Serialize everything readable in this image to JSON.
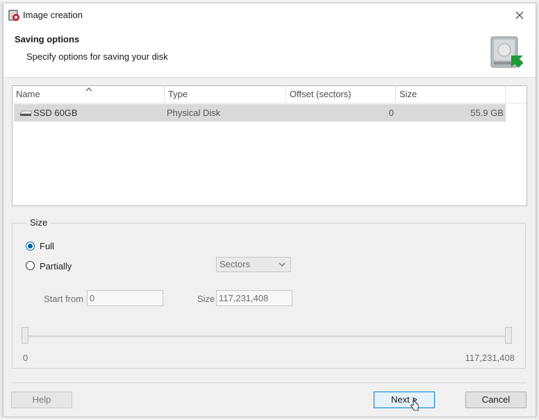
{
  "window": {
    "title": "Image creation",
    "close_icon": "close-icon",
    "app_icon": "image-creation-icon"
  },
  "header": {
    "title": "Saving options",
    "subtitle": "Specify options for saving your disk",
    "icon": "disk-save-icon"
  },
  "disk_list": {
    "columns": [
      "Name",
      "Type",
      "Offset (sectors)",
      "Size"
    ],
    "sorted_column": "Name",
    "rows": [
      {
        "name": "SSD 60GB",
        "type": "Physical Disk",
        "offset": "0",
        "size": "55.9 GB",
        "icon": "disk-icon",
        "selected": true
      }
    ]
  },
  "size_group": {
    "legend": "Size",
    "full_label": "Full",
    "partially_label": "Partially",
    "selected": "Full",
    "unit_select": {
      "value": "Sectors",
      "icon": "chevron-down-icon"
    },
    "start_from_label": "Start from",
    "start_from_value": "0",
    "size_label": "Size",
    "size_value": "117,231,408",
    "range_min": "0",
    "range_max": "117,231,408",
    "range_start_fraction": 0,
    "range_end_fraction": 1
  },
  "buttons": {
    "help": "Help",
    "next": "Next >",
    "cancel": "Cancel"
  },
  "accent": "#0063b1"
}
